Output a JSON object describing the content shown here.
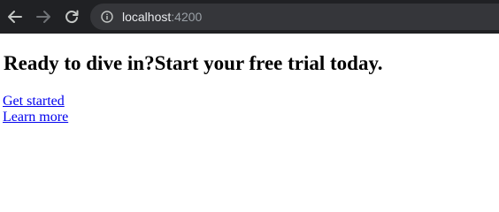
{
  "browser": {
    "url_host": "localhost",
    "url_port": ":4200",
    "icons": {
      "back": "arrow-left-icon",
      "forward": "arrow-right-icon",
      "reload": "reload-icon",
      "info": "info-icon"
    },
    "colors": {
      "toolbar_bg": "#202124",
      "omnibox_bg": "#35363a",
      "url_host": "#e8eaed",
      "url_port": "#9aa0a6"
    }
  },
  "main": {
    "heading": "Ready to dive in?Start your free trial today.",
    "links": {
      "get_started": "Get started",
      "learn_more": "Learn more"
    },
    "colors": {
      "link": "#0000ee",
      "text": "#000000"
    }
  }
}
